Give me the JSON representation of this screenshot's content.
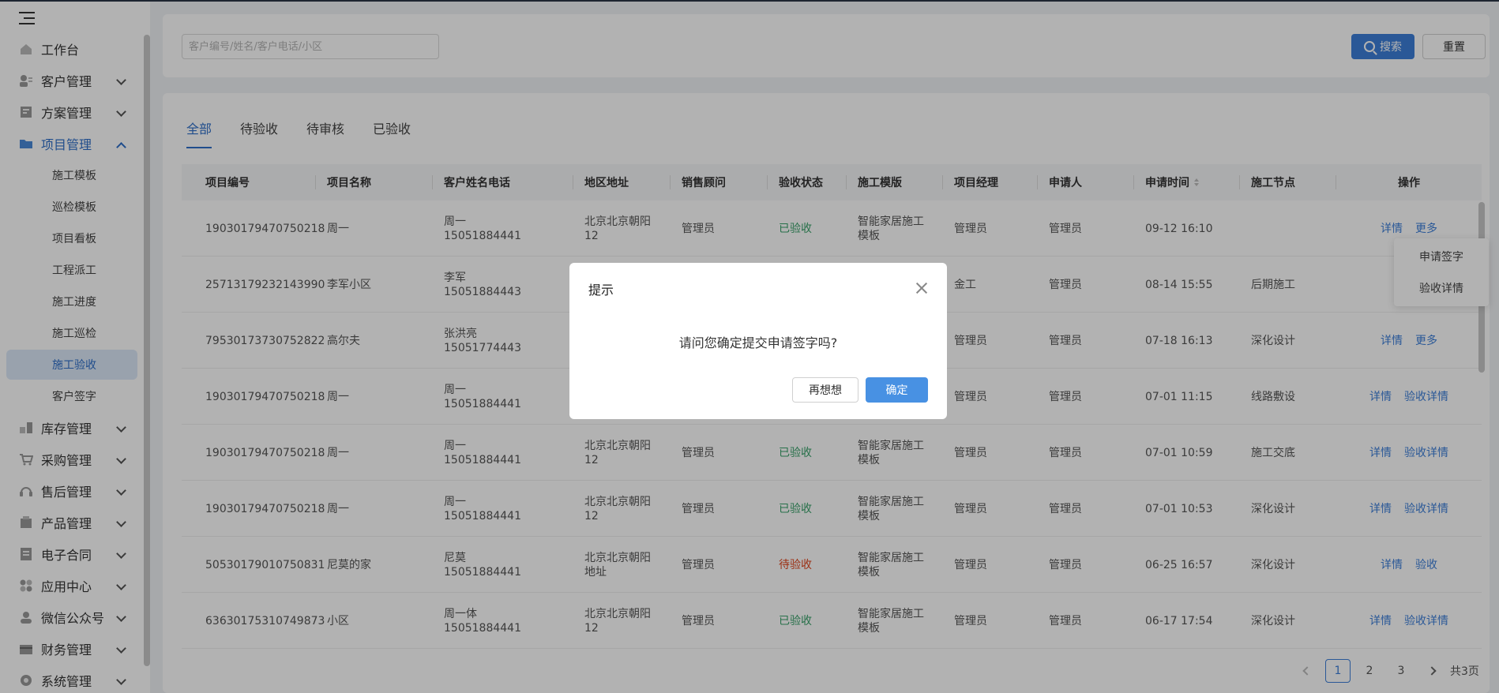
{
  "sidebar": {
    "items": [
      {
        "label": "工作台",
        "icon": "home-icon"
      },
      {
        "label": "客户管理",
        "icon": "customer-icon"
      },
      {
        "label": "方案管理",
        "icon": "plan-icon"
      },
      {
        "label": "项目管理",
        "icon": "folder-icon"
      },
      {
        "label": "库存管理",
        "icon": "inventory-icon"
      },
      {
        "label": "采购管理",
        "icon": "cart-icon"
      },
      {
        "label": "售后管理",
        "icon": "headset-icon"
      },
      {
        "label": "产品管理",
        "icon": "product-icon"
      },
      {
        "label": "电子合同",
        "icon": "contract-icon"
      },
      {
        "label": "应用中心",
        "icon": "apps-icon"
      },
      {
        "label": "微信公众号",
        "icon": "wechat-icon"
      },
      {
        "label": "财务管理",
        "icon": "finance-icon"
      },
      {
        "label": "系统管理",
        "icon": "settings-icon"
      }
    ],
    "sub_items": [
      "施工模板",
      "巡检模板",
      "项目看板",
      "工程派工",
      "施工进度",
      "施工巡检",
      "施工验收",
      "客户签字"
    ],
    "active_sub": "施工验收"
  },
  "search": {
    "placeholder": "客户编号/姓名/客户电话/小区",
    "search_label": "搜索",
    "reset_label": "重置"
  },
  "tabs": [
    "全部",
    "待验收",
    "待审核",
    "已验收"
  ],
  "table": {
    "headers": [
      "项目编号",
      "项目名称",
      "客户姓名电话",
      "地区地址",
      "销售顾问",
      "验收状态",
      "施工模版",
      "项目经理",
      "申请人",
      "申请时间",
      "施工节点",
      "操作"
    ],
    "rows": [
      {
        "id": "19030179470750218",
        "name": "周一",
        "customer": "周一",
        "phone": "15051884441",
        "addr1": "北京北京朝阳",
        "addr2": "12",
        "sales": "管理员",
        "status": "已验收",
        "tpl1": "智能家居施工",
        "tpl2": "模板",
        "pm": "管理员",
        "applicant": "管理员",
        "time": "09-12 16:10",
        "node": "",
        "op1": "详情",
        "op2": "更多"
      },
      {
        "id": "25713179232143990",
        "name": "李军小区",
        "customer": "李军",
        "phone": "15051884443",
        "addr1": "",
        "addr2": "",
        "sales": "",
        "status": "",
        "tpl1": "",
        "tpl2": "",
        "pm": "金工",
        "applicant": "管理员",
        "time": "08-14 15:55",
        "node": "后期施工",
        "op1": "",
        "op2": ""
      },
      {
        "id": "79530173730752822",
        "name": "高尔夫",
        "customer": "张洪亮",
        "phone": "15051774443",
        "addr1": "",
        "addr2": "",
        "sales": "",
        "status": "",
        "tpl1": "",
        "tpl2": "",
        "pm": "管理员",
        "applicant": "管理员",
        "time": "07-18 16:13",
        "node": "深化设计",
        "op1": "详情",
        "op2": "更多"
      },
      {
        "id": "19030179470750218",
        "name": "周一",
        "customer": "周一",
        "phone": "15051884441",
        "addr1": "",
        "addr2": "",
        "sales": "",
        "status": "",
        "tpl1": "",
        "tpl2": "",
        "pm": "管理员",
        "applicant": "管理员",
        "time": "07-01 11:15",
        "node": "线路敷设",
        "op1": "详情",
        "op2": "验收详情"
      },
      {
        "id": "19030179470750218",
        "name": "周一",
        "customer": "周一",
        "phone": "15051884441",
        "addr1": "北京北京朝阳",
        "addr2": "12",
        "sales": "管理员",
        "status": "已验收",
        "tpl1": "智能家居施工",
        "tpl2": "模板",
        "pm": "管理员",
        "applicant": "管理员",
        "time": "07-01 10:59",
        "node": "施工交底",
        "op1": "详情",
        "op2": "验收详情"
      },
      {
        "id": "19030179470750218",
        "name": "周一",
        "customer": "周一",
        "phone": "15051884441",
        "addr1": "北京北京朝阳",
        "addr2": "12",
        "sales": "管理员",
        "status": "已验收",
        "tpl1": "智能家居施工",
        "tpl2": "模板",
        "pm": "管理员",
        "applicant": "管理员",
        "time": "07-01 10:53",
        "node": "深化设计",
        "op1": "详情",
        "op2": "验收详情"
      },
      {
        "id": "50530179010750831",
        "name": "尼莫的家",
        "customer": "尼莫",
        "phone": "15051884441",
        "addr1": "北京北京朝阳",
        "addr2": "地址",
        "sales": "管理员",
        "status": "待验收",
        "tpl1": "智能家居施工",
        "tpl2": "模板",
        "pm": "管理员",
        "applicant": "管理员",
        "time": "06-25 16:57",
        "node": "深化设计",
        "op1": "详情",
        "op2": "验收"
      },
      {
        "id": "63630175310749873",
        "name": "小区",
        "customer": "周一体",
        "phone": "15051884441",
        "addr1": "北京北京朝阳",
        "addr2": "12",
        "sales": "管理员",
        "status": "已验收",
        "tpl1": "智能家居施工",
        "tpl2": "模板",
        "pm": "管理员",
        "applicant": "管理员",
        "time": "06-17 17:54",
        "node": "深化设计",
        "op1": "详情",
        "op2": "验收详情"
      }
    ]
  },
  "dropdown": [
    "申请签字",
    "验收详情"
  ],
  "pagination": {
    "pages": [
      "1",
      "2",
      "3"
    ],
    "current": "1",
    "total": "共3页"
  },
  "modal": {
    "title": "提示",
    "message": "请问您确定提交申请签字吗?",
    "cancel": "再想想",
    "confirm": "确定"
  },
  "colors": {
    "accent": "#3d7fd9",
    "success": "#38a169",
    "warning": "#e0461d"
  }
}
